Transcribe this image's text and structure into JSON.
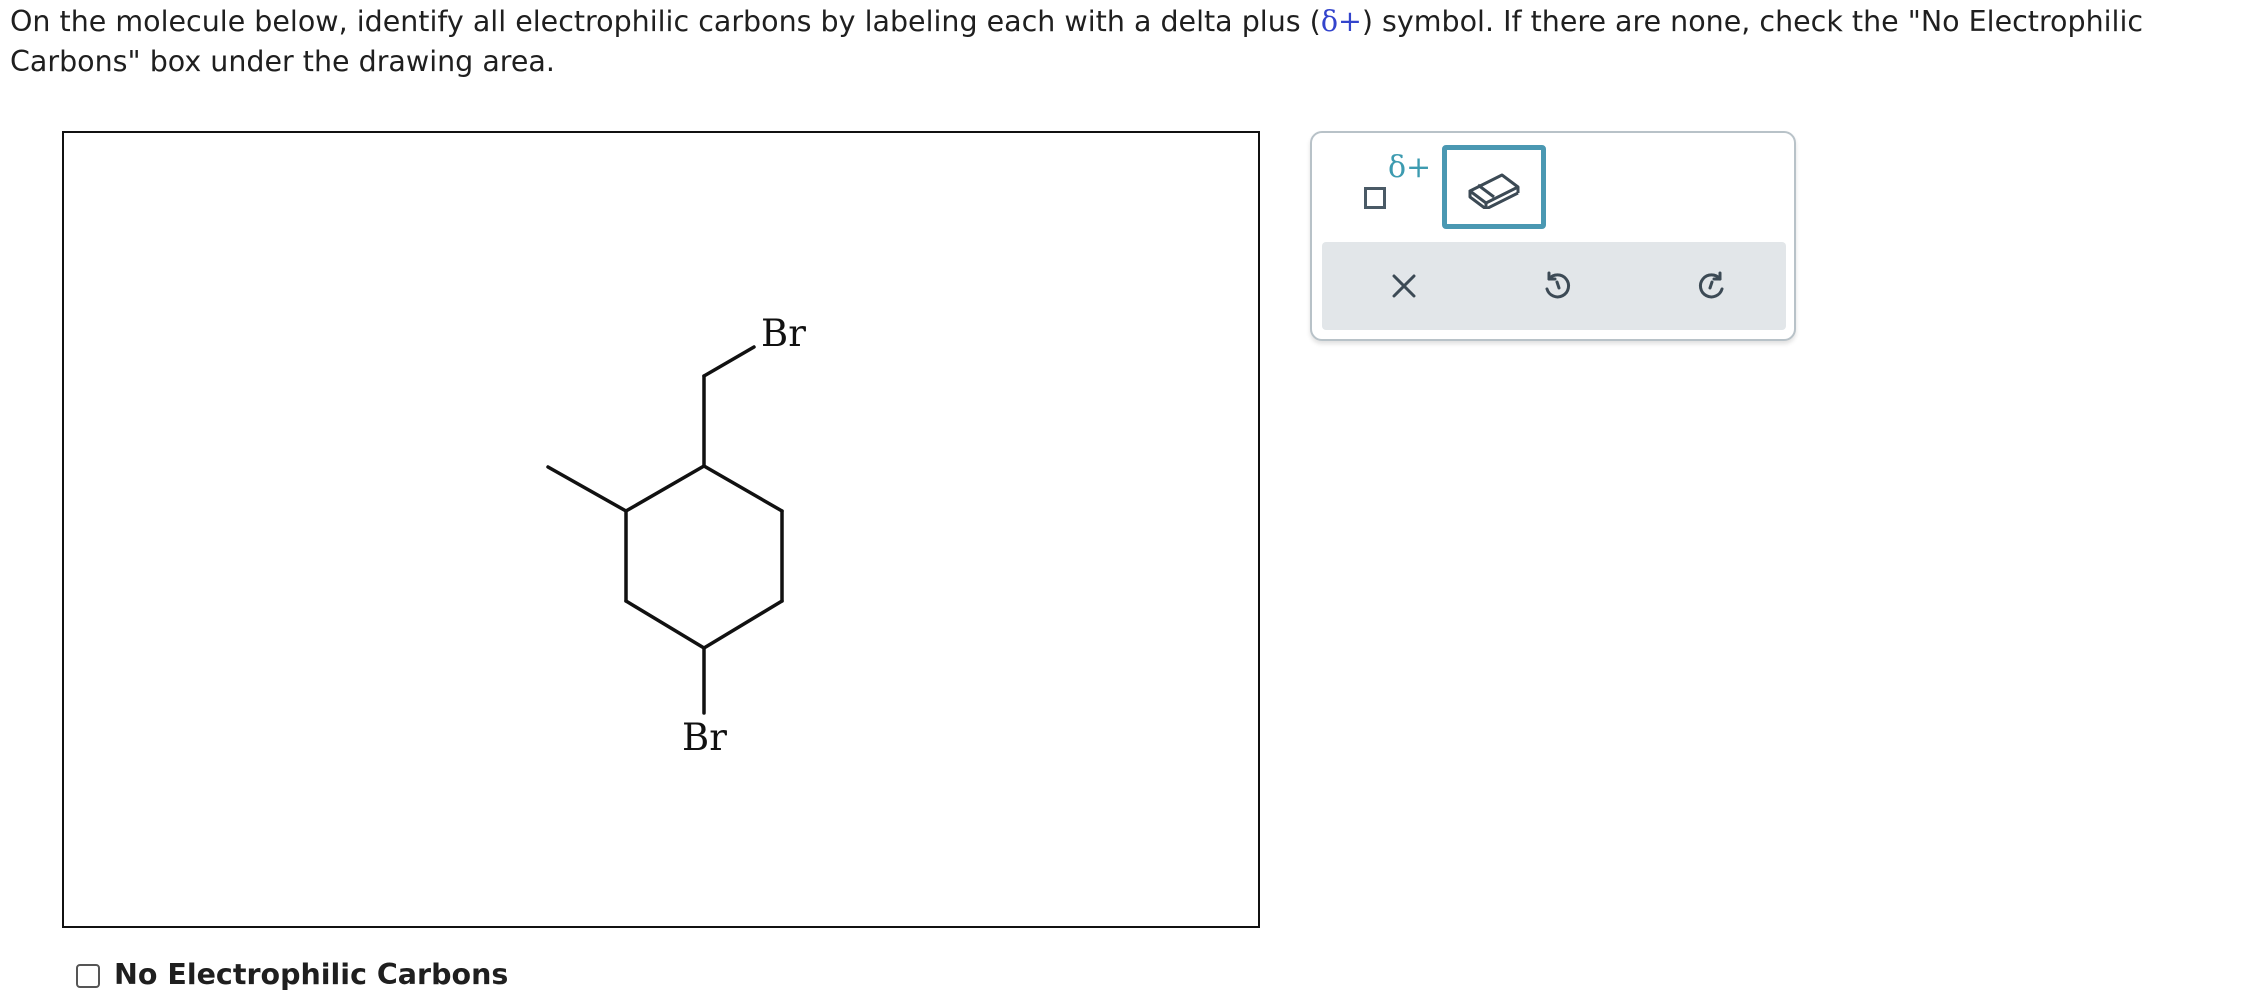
{
  "instructions": {
    "part1": "On the molecule below, identify all electrophilic carbons by labeling each with a delta plus (",
    "delta_symbol": "δ+",
    "part2": ") symbol. If there are none, check the \"No Electrophilic Carbons\" box under the drawing area."
  },
  "molecule": {
    "atom_labels": [
      "Br",
      "Br"
    ]
  },
  "toolbar": {
    "delta_tool_label": "δ+",
    "eraser_icon": "eraser-icon",
    "clear_icon": "close-icon",
    "undo_icon": "undo-icon",
    "redo_icon": "redo-icon",
    "accent_color": "#4a98b2",
    "delta_color": "#3d9bb0"
  },
  "checkbox": {
    "label": "No Electrophilic Carbons",
    "checked": false
  }
}
